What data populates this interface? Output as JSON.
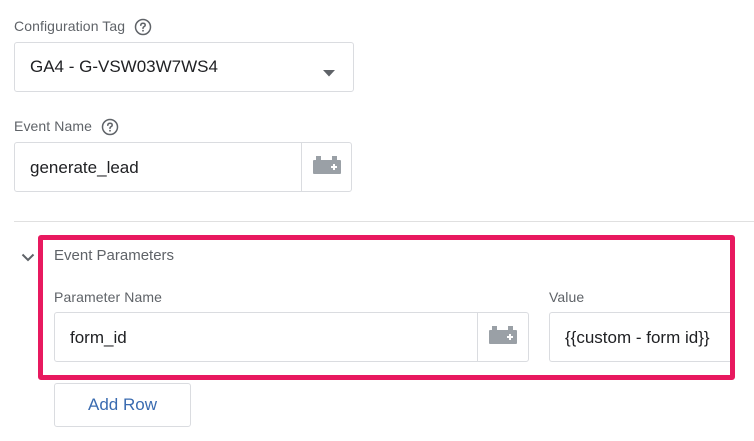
{
  "config_tag": {
    "label": "Configuration Tag",
    "value": "GA4 - G-VSW03W7WS4"
  },
  "event_name": {
    "label": "Event Name",
    "value": "generate_lead"
  },
  "event_parameters": {
    "title": "Event Parameters",
    "param_name_label": "Parameter Name",
    "value_label": "Value",
    "rows": [
      {
        "name": "form_id",
        "value": "{{custom - form id}}"
      }
    ],
    "add_row_label": "Add Row"
  },
  "colors": {
    "highlight": "#e8195f",
    "link_blue": "#3a6bb0",
    "label_gray": "#5f6368",
    "border": "#dadce0"
  }
}
